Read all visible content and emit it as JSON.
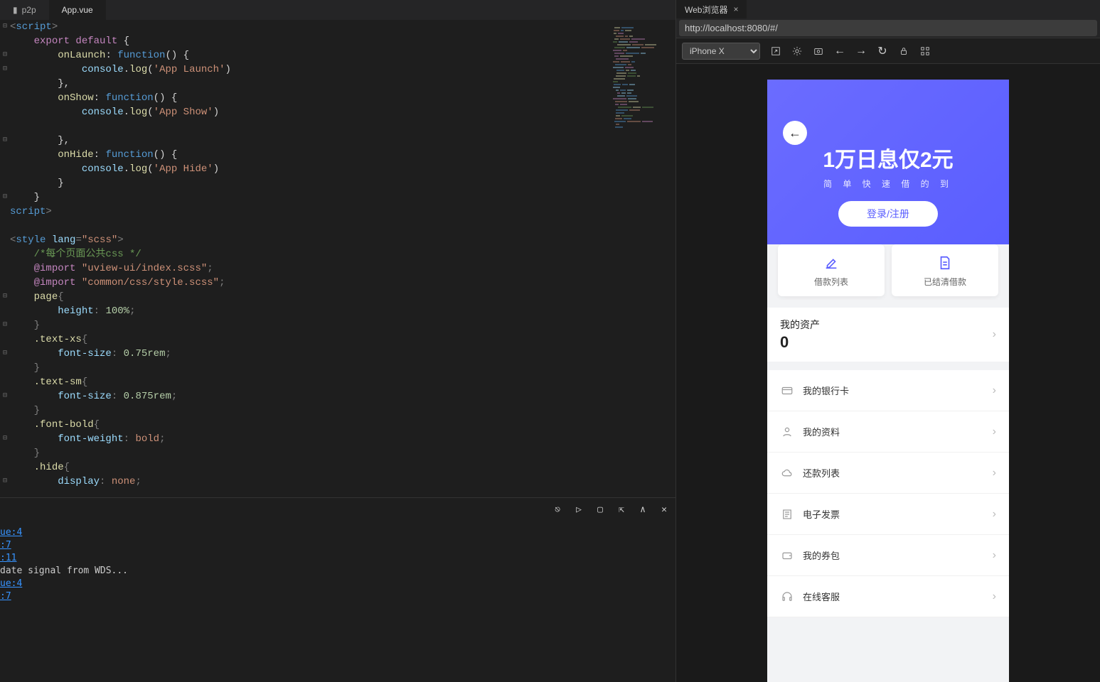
{
  "ide": {
    "tabs": [
      {
        "label": "p2p",
        "type": "folder"
      },
      {
        "label": "App.vue",
        "type": "file",
        "active": true
      }
    ],
    "gutter_marks": [
      "⊟",
      "",
      "⊟",
      "⊟",
      "",
      "",
      "",
      "",
      "⊟",
      "",
      "",
      "",
      "⊟",
      "",
      "",
      "",
      "",
      "",
      "",
      "⊟",
      "",
      "⊟",
      "",
      "⊟",
      "",
      "",
      "⊟",
      "",
      "",
      "⊟",
      "",
      "",
      "⊟",
      ""
    ],
    "code": {
      "l1": {
        "a": "<",
        "b": "script",
        "c": ">"
      },
      "l2": {
        "a": "export default",
        "b": " {"
      },
      "l3": {
        "a": "onLaunch",
        "b": ": ",
        "c": "function",
        "d": "() {"
      },
      "l4": {
        "a": "console",
        "b": ".",
        "c": "log",
        "d": "(",
        "e": "'App Launch'",
        "f": ")"
      },
      "l5": "},",
      "l6": {
        "a": "onShow",
        "b": ": ",
        "c": "function",
        "d": "() {"
      },
      "l7": {
        "a": "console",
        "b": ".",
        "c": "log",
        "d": "(",
        "e": "'App Show'",
        "f": ")"
      },
      "l8": "",
      "l9": "},",
      "l10": {
        "a": "onHide",
        "b": ": ",
        "c": "function",
        "d": "() {"
      },
      "l11": {
        "a": "console",
        "b": ".",
        "c": "log",
        "d": "(",
        "e": "'App Hide'",
        "f": ")"
      },
      "l12": "}",
      "l13": "}",
      "l14": {
        "a": "</",
        "b": "script",
        "c": ">"
      },
      "l15": "",
      "l16": {
        "a": "<",
        "b": "style",
        "c": " lang",
        "d": "=",
        "e": "\"scss\"",
        "f": ">"
      },
      "l17": "/*每个页面公共css */",
      "l18": {
        "a": "@import",
        "b": " ",
        "c": "\"uview-ui/index.scss\"",
        "d": ";"
      },
      "l19": {
        "a": "@import",
        "b": " ",
        "c": "\"common/css/style.scss\"",
        "d": ";"
      },
      "l20": {
        "a": "page",
        "b": "{"
      },
      "l21": {
        "a": "height",
        "b": ": ",
        "c": "100%",
        "d": ";"
      },
      "l22": "}",
      "l23": {
        "a": ".text-xs",
        "b": "{"
      },
      "l24": {
        "a": "font-size",
        "b": ": ",
        "c": "0.75rem",
        "d": ";"
      },
      "l25": "}",
      "l26": {
        "a": ".text-sm",
        "b": "{"
      },
      "l27": {
        "a": "font-size",
        "b": ": ",
        "c": "0.875rem",
        "d": ";"
      },
      "l28": "}",
      "l29": {
        "a": ".font-bold",
        "b": "{"
      },
      "l30": {
        "a": "font-weight",
        "b": ": ",
        "c": "bold",
        "d": ";"
      },
      "l31": "}",
      "l32": {
        "a": ".hide",
        "b": "{"
      },
      "l33": {
        "a": "display",
        "b": ": ",
        "c": "none",
        "d": ";"
      }
    },
    "console": {
      "lines": [
        {
          "text": "ue:4",
          "link": true
        },
        {
          "text": ":7",
          "link": true
        },
        {
          "text": ":11",
          "link": true
        },
        {
          "text": "date signal from WDS...",
          "link": false
        },
        {
          "text": "ue:4",
          "link": true
        },
        {
          "text": ":7",
          "link": true
        }
      ]
    }
  },
  "browser": {
    "tab_title": "Web浏览器",
    "url": "http://localhost:8080/#/",
    "device": "iPhone X"
  },
  "app": {
    "hero": {
      "title": "1万日息仅2元",
      "subtitle": "简 单 快 速 借 的 到",
      "login_btn": "登录/注册"
    },
    "cards": [
      {
        "label": "借款列表",
        "icon": "edit"
      },
      {
        "label": "已结清借款",
        "icon": "doc"
      }
    ],
    "asset": {
      "label": "我的资产",
      "value": "0"
    },
    "list": [
      {
        "label": "我的银行卡",
        "icon": "card"
      },
      {
        "label": "我的资料",
        "icon": "user"
      },
      {
        "label": "还款列表",
        "icon": "cloud"
      },
      {
        "label": "电子发票",
        "icon": "receipt"
      },
      {
        "label": "我的券包",
        "icon": "wallet"
      },
      {
        "label": "在线客服",
        "icon": "headset"
      }
    ]
  }
}
